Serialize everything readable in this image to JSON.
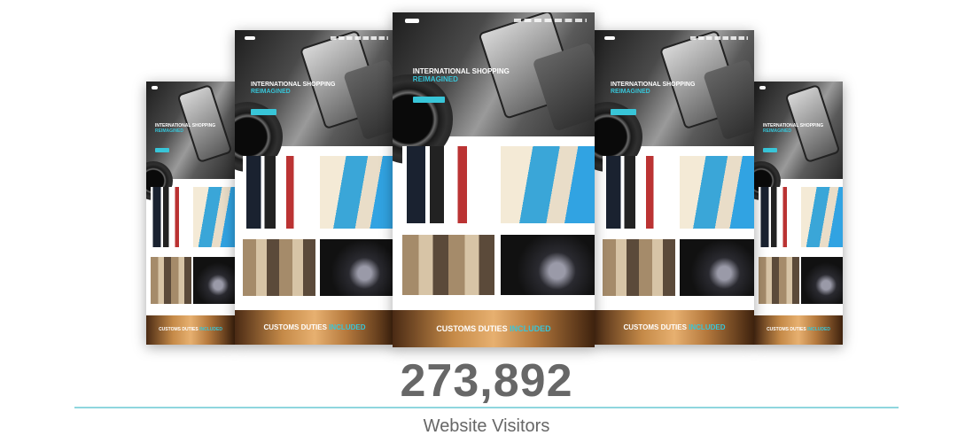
{
  "hero": {
    "line1": "INTERNATIONAL SHOPPING",
    "line2": "REIMAGINED"
  },
  "footer": {
    "part1": "CUSTOMS DUTIES",
    "part2": "INCLUDED"
  },
  "stat": {
    "value": "273,892",
    "label": "Website Visitors"
  },
  "colors": {
    "accent": "#38c5d8",
    "stat_text": "#676767",
    "divider": "#8fd6de"
  }
}
